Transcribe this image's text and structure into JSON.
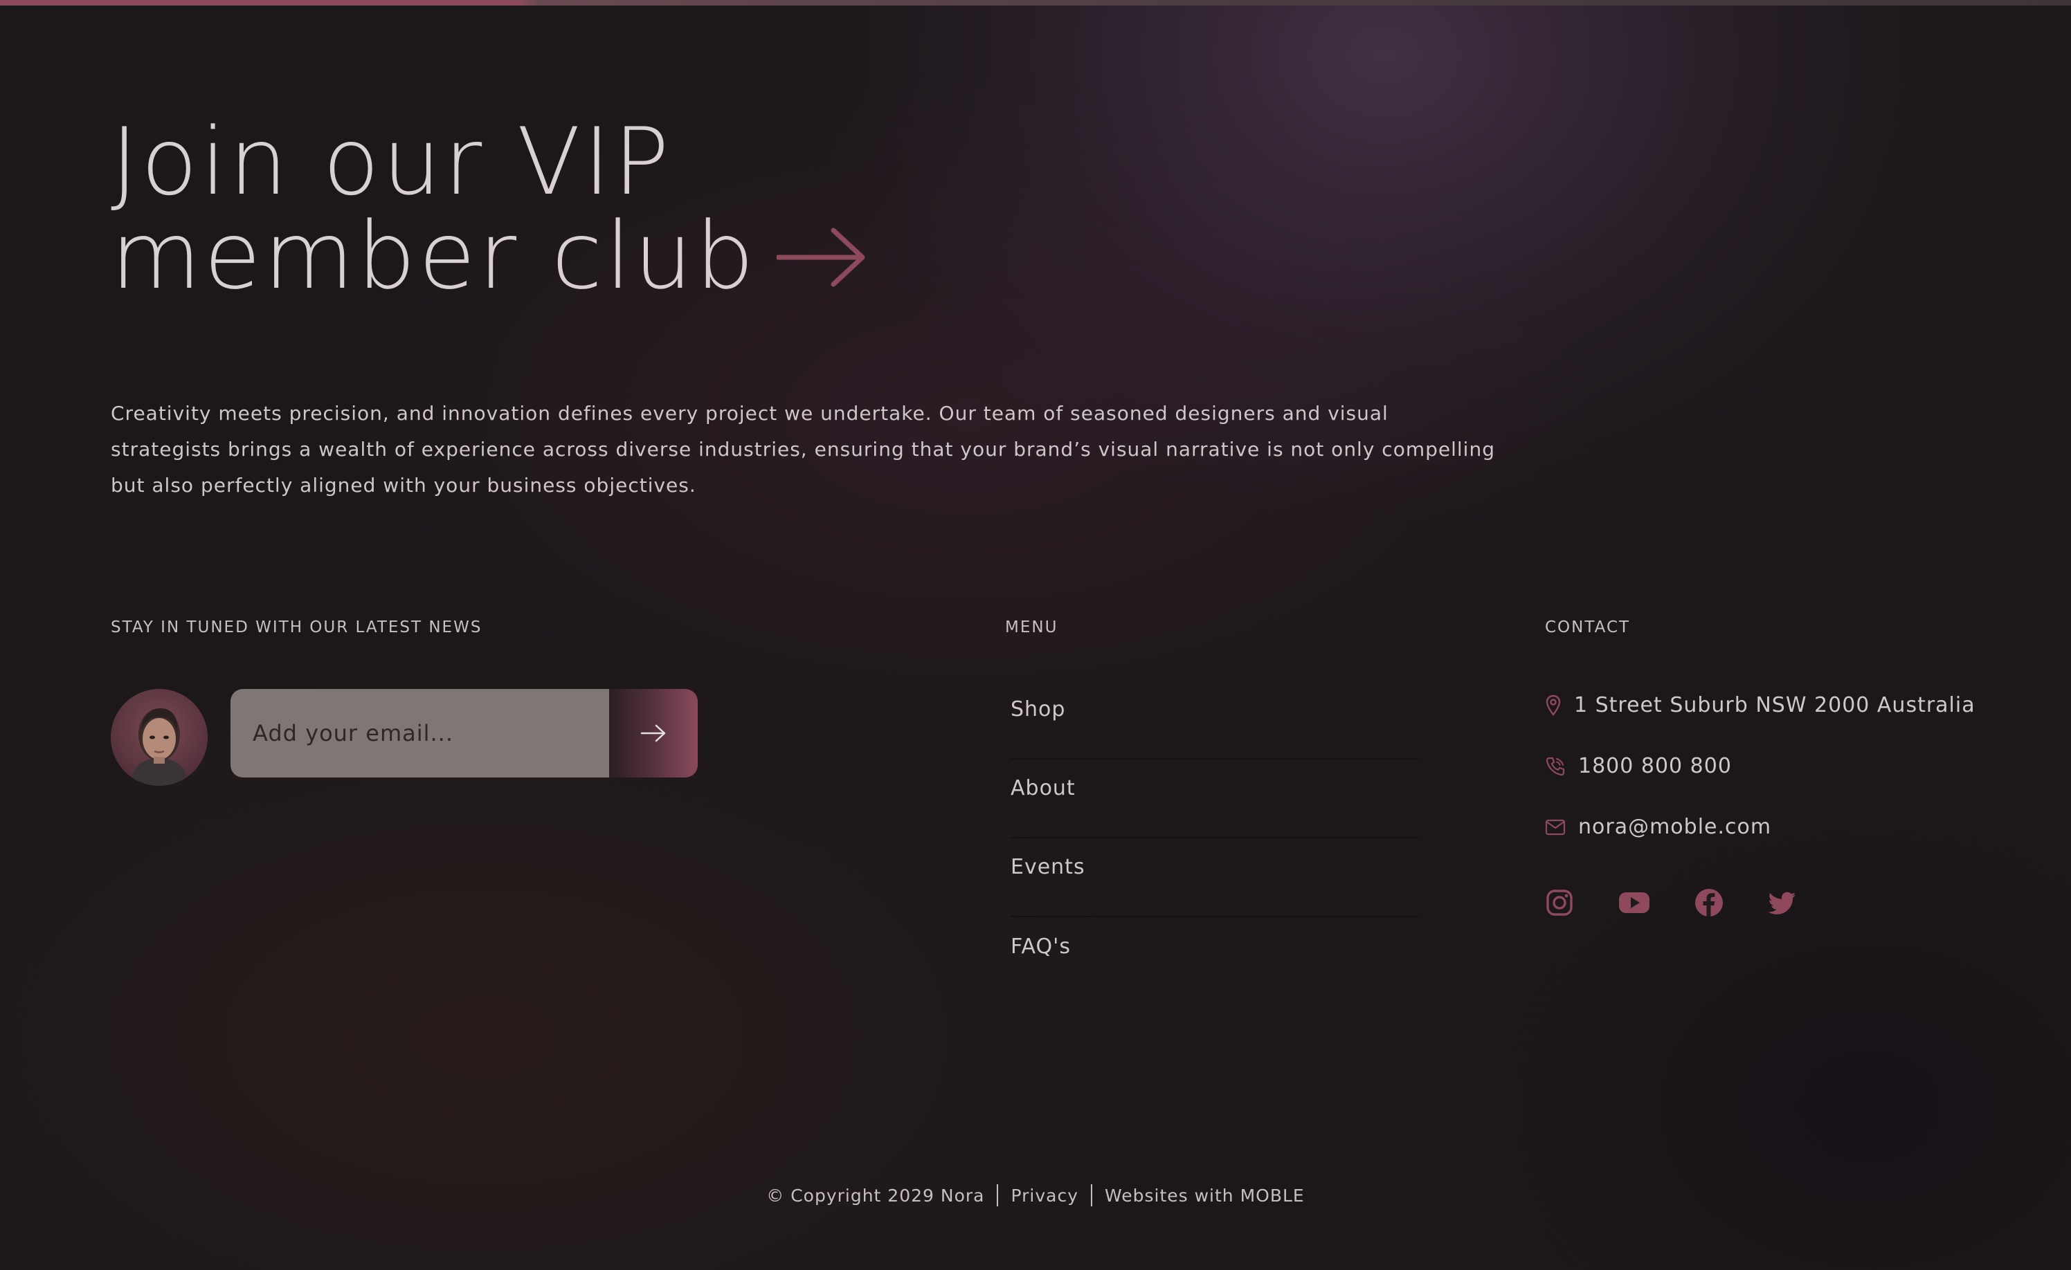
{
  "hero": {
    "headline_line1": "Join our VIP",
    "headline_line2": "member club",
    "intro": "Creativity meets precision, and innovation defines every project we undertake. Our team of seasoned designers and visual strategists brings a wealth of experience across diverse industries, ensuring that your brand’s visual narrative is not only compelling but also perfectly aligned with your business objectives."
  },
  "newsletter": {
    "label": "STAY IN TUNED WITH OUR LATEST NEWS",
    "email_placeholder": "Add your email...",
    "email_value": ""
  },
  "menu": {
    "label": "MENU",
    "items": [
      {
        "label": "Shop"
      },
      {
        "label": "About"
      },
      {
        "label": "Events"
      },
      {
        "label": "FAQ's"
      }
    ]
  },
  "contact": {
    "label": "CONTACT",
    "address": "1 Street Suburb NSW 2000 Australia",
    "phone": "1800 800 800",
    "email": "nora@moble.com",
    "icons": [
      "map-pin-icon",
      "phone-icon",
      "mail-icon"
    ],
    "socials": [
      "instagram-icon",
      "youtube-icon",
      "facebook-icon",
      "twitter-icon"
    ]
  },
  "footer": {
    "copyright": "© Copyright 2029 Nora",
    "privacy": "Privacy",
    "credit": "Websites with MOBLE"
  },
  "colors": {
    "accent": "#8e4a5c",
    "text": "#d0c7ca",
    "background": "#1c181a"
  }
}
